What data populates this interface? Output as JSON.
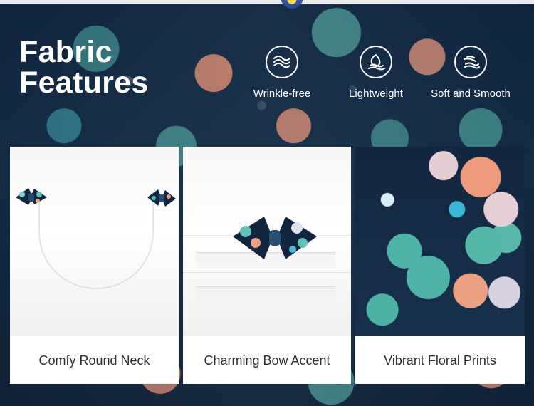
{
  "header": {
    "title_line1": "Fabric",
    "title_line2": "Features"
  },
  "features": [
    {
      "label": "Wrinkle-free",
      "icon": "wrinkle-free-icon"
    },
    {
      "label": "Lightweight",
      "icon": "lightweight-icon"
    },
    {
      "label": "Soft and Smooth",
      "icon": "soft-smooth-icon"
    }
  ],
  "cards": [
    {
      "caption": "Comfy Round Neck"
    },
    {
      "caption": "Charming Bow Accent"
    },
    {
      "caption": "Vibrant Floral Prints"
    }
  ],
  "colors": {
    "background": "#13263f",
    "teal": "#4fb4a7",
    "coral": "#ee9a7c",
    "white": "#ffffff",
    "caption_text": "#2f2f2f"
  }
}
